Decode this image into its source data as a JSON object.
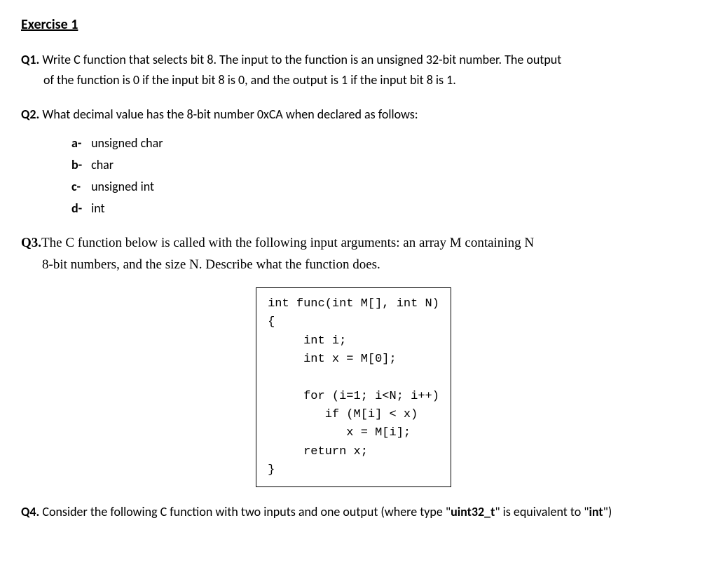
{
  "title": "Exercise 1",
  "q1": {
    "label": "Q1.",
    "line1": "Write C function that selects bit 8. The input to the function is an unsigned 32-bit number. The output",
    "line2": "of the function is 0 if the input bit 8 is 0, and the output is 1 if the input bit 8 is 1."
  },
  "q2": {
    "label": "Q2.",
    "text": "What decimal value has the 8-bit number 0xCA when declared as follows:",
    "items": [
      {
        "label": "a-",
        "text": "unsigned char"
      },
      {
        "label": "b-",
        "text": "char"
      },
      {
        "label": "c-",
        "text": "unsigned int"
      },
      {
        "label": "d-",
        "text": "int"
      }
    ]
  },
  "q3": {
    "label": "Q3.",
    "line1": "The C function below is called with the following input arguments: an array M containing N",
    "line2": "8-bit numbers, and the size N. Describe what the function does.",
    "code": "int func(int M[], int N)\n{\n     int i;\n     int x = M[0];\n\n     for (i=1; i<N; i++)\n        if (M[i] < x)\n           x = M[i];\n     return x;\n}"
  },
  "q4": {
    "label": "Q4.",
    "text_part1": " Consider the following C function with two inputs and one output (where type \"",
    "bold1": "uint32_t",
    "text_part2": "\" is equivalent to \"",
    "bold2": "int",
    "text_part3": "\")"
  }
}
